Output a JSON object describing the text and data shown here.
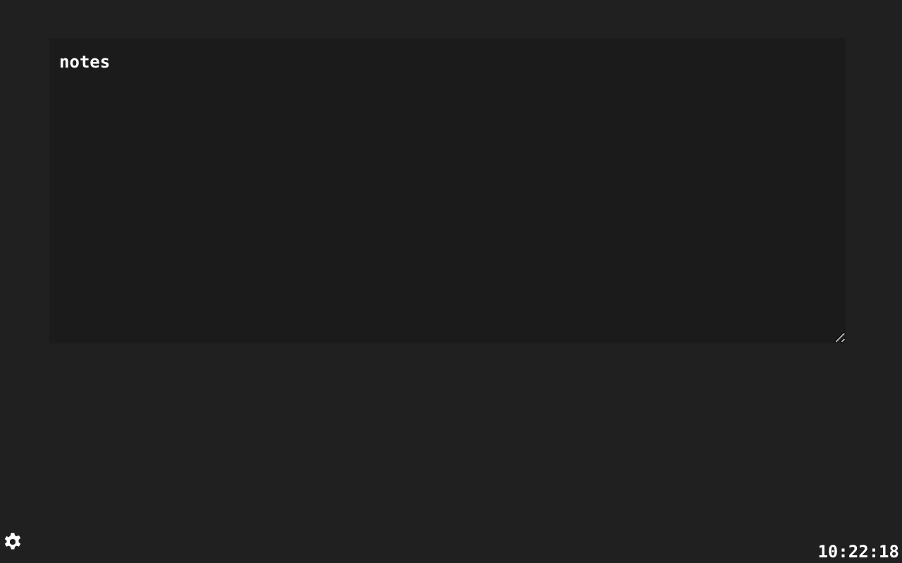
{
  "notes": {
    "value": "notes"
  },
  "clock": "10:22:18"
}
